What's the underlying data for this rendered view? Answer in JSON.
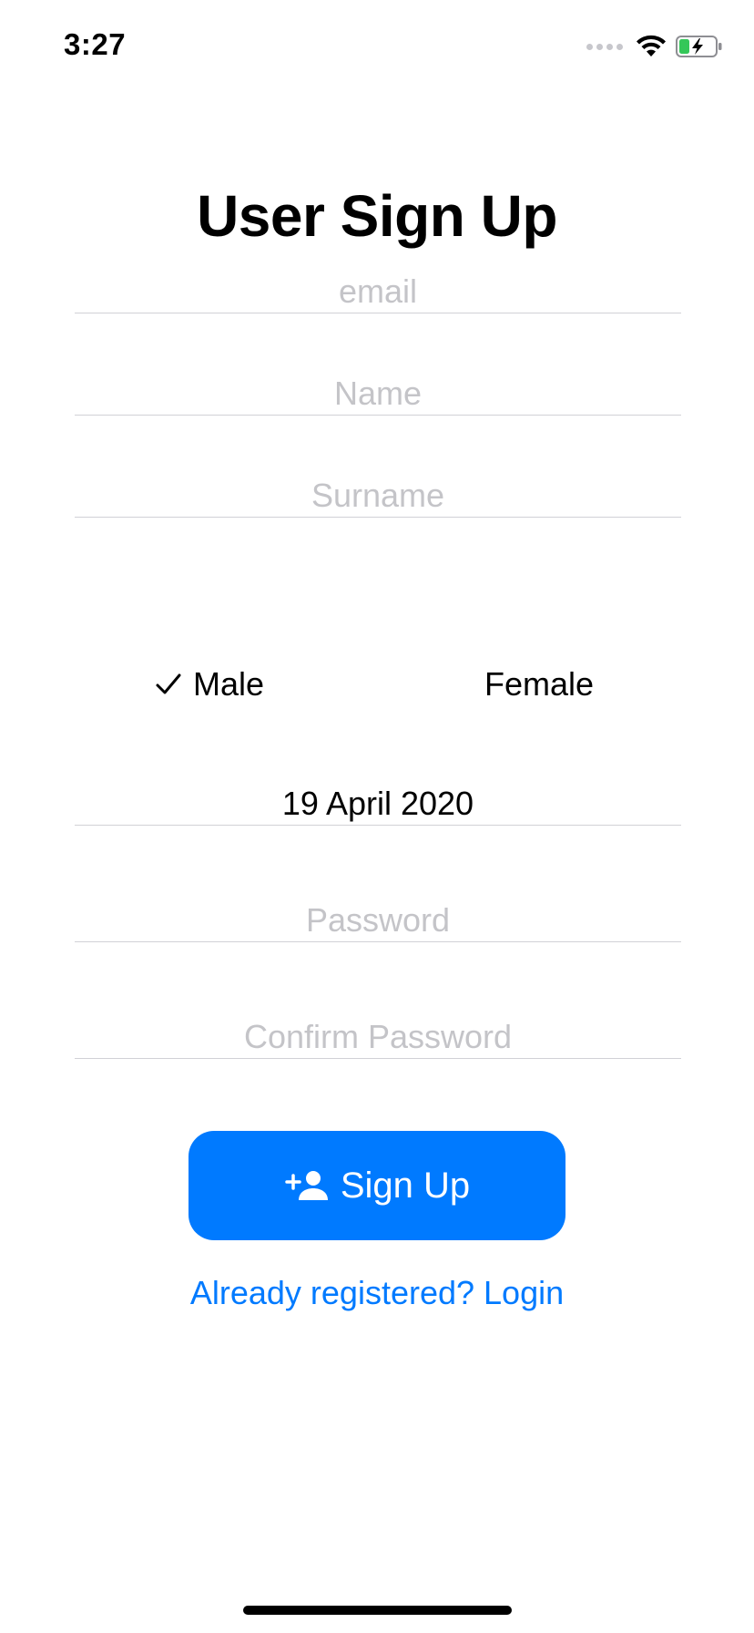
{
  "status_bar": {
    "time": "3:27",
    "icons": [
      "signal-dots-icon",
      "wifi-icon",
      "battery-charging-icon"
    ],
    "battery_color": "#34c759"
  },
  "title": "User Sign Up",
  "form": {
    "email": {
      "placeholder": "email",
      "value": ""
    },
    "name": {
      "placeholder": "Name",
      "value": ""
    },
    "surname": {
      "placeholder": "Surname",
      "value": ""
    },
    "gender": {
      "options": [
        "Male",
        "Female"
      ],
      "selected": "Male"
    },
    "birth_date": "19 April 2020",
    "password": {
      "placeholder": "Password",
      "value": ""
    },
    "confirm_password": {
      "placeholder": "Confirm Password",
      "value": ""
    }
  },
  "signup_button": {
    "label": "Sign Up",
    "icon": "person-add-icon",
    "color": "#007aff"
  },
  "login_link": "Already registered? Login",
  "colors": {
    "accent": "#007aff",
    "placeholder": "#c4c4c8",
    "divider": "#d1d1d6"
  }
}
